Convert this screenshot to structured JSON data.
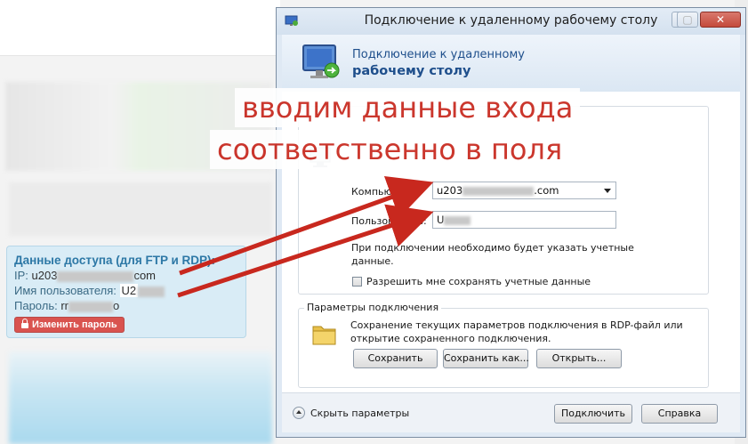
{
  "background_page": {
    "access_box": {
      "title": "Данные доступа (для FTP и RDP):",
      "ip_label": "IP:",
      "ip_value_prefix": "u203",
      "ip_value_suffix": "com",
      "user_label": "Имя пользователя:",
      "user_value_prefix": "U2",
      "password_label": "Пароль:",
      "password_value_prefix": "rr",
      "password_value_suffix": "o",
      "change_password_button": "Изменить пароль"
    }
  },
  "window": {
    "title": "Подключение к удаленному рабочему столу",
    "controls": {
      "minimize": "—",
      "maximize": "▢",
      "close": "✕"
    },
    "header": {
      "line1": "Подключение к удаленному",
      "line2": "рабочему столу"
    },
    "form": {
      "computer_label": "Компьютер:",
      "computer_value_prefix": "u203",
      "computer_value_suffix": ".com",
      "user_label": "Пользователь:",
      "user_value_prefix": "U",
      "note_line1": "При подключении необходимо будет указать учетные",
      "note_line2": "данные.",
      "save_credentials_label": "Разрешить мне сохранять учетные данные"
    },
    "connection_params": {
      "group_title": "Параметры подключения",
      "description_line1": "Сохранение текущих параметров подключения в RDP-файл или",
      "description_line2": "открытие сохраненного подключения.",
      "save_button": "Сохранить",
      "save_as_button": "Сохранить как...",
      "open_button": "Открыть..."
    },
    "footer": {
      "hide_params": "Скрыть параметры",
      "connect_button": "Подключить",
      "help_button": "Справка"
    }
  },
  "annotation": {
    "line1": "вводим данные входа",
    "line2": "соответственно в поля",
    "color": "#c8281e"
  }
}
